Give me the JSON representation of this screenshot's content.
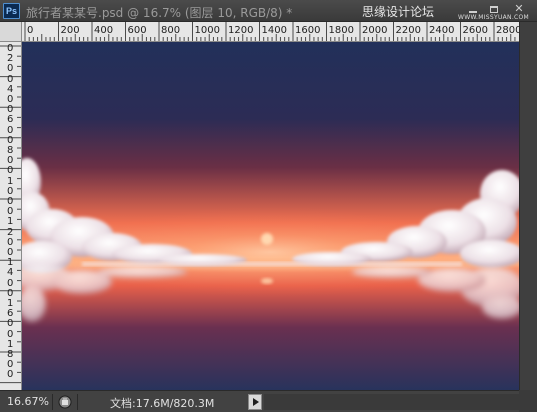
{
  "app": {
    "logo_label": "Ps",
    "document_title": "旅行者某某号.psd @ 16.7% (图层 10, RGB/8) *",
    "watermark_text": "思缘设计论坛",
    "watermark_site": "WWW.MISSYUAN.COM",
    "window_buttons": [
      "minimize",
      "maximize",
      "close"
    ],
    "close_label": "✕"
  },
  "ruler": {
    "horizontal_labels": [
      "0",
      "200",
      "400",
      "600",
      "800",
      "1000",
      "1200",
      "1400",
      "1600",
      "1800",
      "2000",
      "2200",
      "2400",
      "2600",
      "2800"
    ],
    "vertical_labels": [
      "0",
      "2",
      "0",
      "0",
      "4",
      "0",
      "0",
      "6",
      "0",
      "0",
      "8",
      "0",
      "0",
      "1",
      "0",
      "0",
      "0",
      "1",
      "2",
      "0",
      "0",
      "1",
      "4",
      "0",
      "0",
      "1",
      "6",
      "0",
      "0",
      "1",
      "8",
      "0",
      "0"
    ]
  },
  "canvas": {
    "image_description_icon": "sunset-clouds-image",
    "colors": {
      "sky_top": "#22305a",
      "sky_mid": "#6a2f45",
      "horizon_glow": "#f07050",
      "horizon_core": "#ffb080",
      "water_bottom": "#28335c",
      "cloud": "#f2e8ec"
    }
  },
  "status": {
    "zoom": "16.67%",
    "doc_size": "文档:17.6M/820.3M",
    "status_icon": "document-info-icon",
    "menu_arrow_icon": "triangle-right-icon"
  }
}
